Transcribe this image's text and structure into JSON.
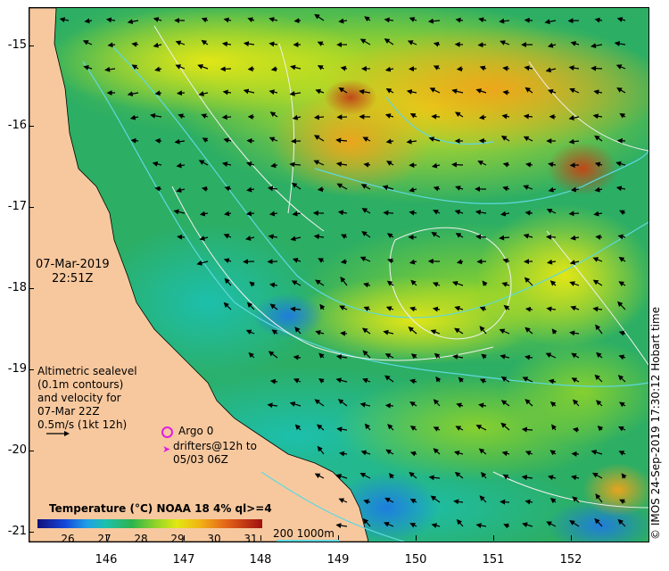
{
  "map": {
    "y_ticks": [
      "-15",
      "-16",
      "-17",
      "-18",
      "-19",
      "-20",
      "-21"
    ],
    "x_ticks": [
      "146",
      "147",
      "148",
      "149",
      "150",
      "151",
      "152"
    ],
    "date_line1": "07-Mar-2019",
    "date_line2": "22:51Z",
    "altimetry_lines": [
      "Altimetric sealevel",
      "(0.1m contours)",
      "and velocity for",
      "07-Mar 22Z",
      "0.5m/s (1kt 12h)"
    ],
    "argo_label": "Argo 0",
    "drifter_lines": [
      "drifters@12h to",
      "05/03 06Z"
    ],
    "colorbar": {
      "title": "Temperature (°C) NOAA 18 4% ql>=4",
      "ticks": [
        "26",
        "27",
        "28",
        "29",
        "30",
        "31"
      ]
    },
    "isobath_legend": "200  1000m",
    "credit": "© IMOS 24-Sep-2019 17:30:12 Hobart time",
    "colors": {
      "land": "#f7c89e",
      "sea_base": "#2cae64",
      "isobath": "#5fd8e0",
      "contour": "#f0f0f0",
      "argo": "#e020e0"
    }
  }
}
